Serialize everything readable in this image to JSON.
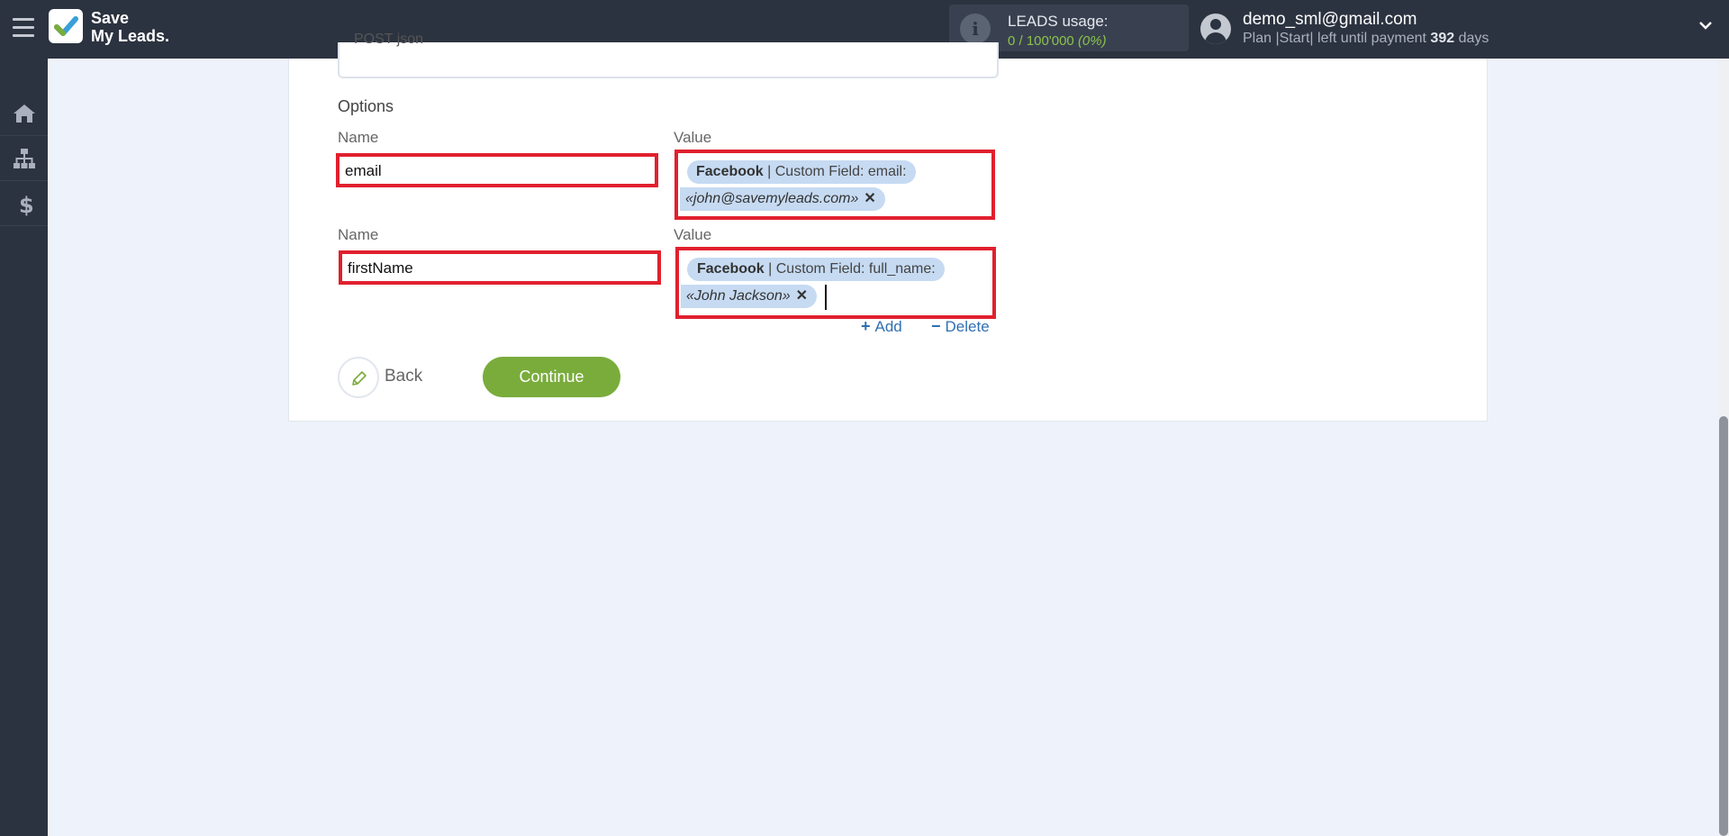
{
  "header": {
    "logo_line1": "Save",
    "logo_line2": "My Leads.",
    "usage_title": "LEADS usage:",
    "usage_count": "0 / 100'000",
    "usage_percent": "(0%)",
    "account_email": "demo_sml@gmail.com",
    "plan_text": "Plan |Start| left until payment",
    "plan_days": "392",
    "plan_days_suffix": "days"
  },
  "sidebar": {
    "items": [
      {
        "icon": "home-icon"
      },
      {
        "icon": "sitemap-icon"
      },
      {
        "icon": "dollar-icon"
      }
    ]
  },
  "form": {
    "method_value": "POST json",
    "options_label": "Options",
    "rows": [
      {
        "name_label": "Name",
        "name_value": "email",
        "value_label": "Value",
        "chip_source": "Facebook",
        "chip_field": " | Custom Field: email:",
        "chip_sample": "«john@savemyleads.com»"
      },
      {
        "name_label": "Name",
        "name_value": "firstName",
        "value_label": "Value",
        "chip_source": "Facebook",
        "chip_field": " | Custom Field: full_name:",
        "chip_sample": "«John Jackson»"
      }
    ],
    "add_label": "Add",
    "delete_label": "Delete",
    "back_label": "Back",
    "continue_label": "Continue"
  },
  "colors": {
    "topbar": "#2c3340",
    "accent_green": "#7aac3c",
    "highlight_red": "#e1202e",
    "chip_blue": "#c6daf2",
    "link_blue": "#2f6fb2"
  }
}
